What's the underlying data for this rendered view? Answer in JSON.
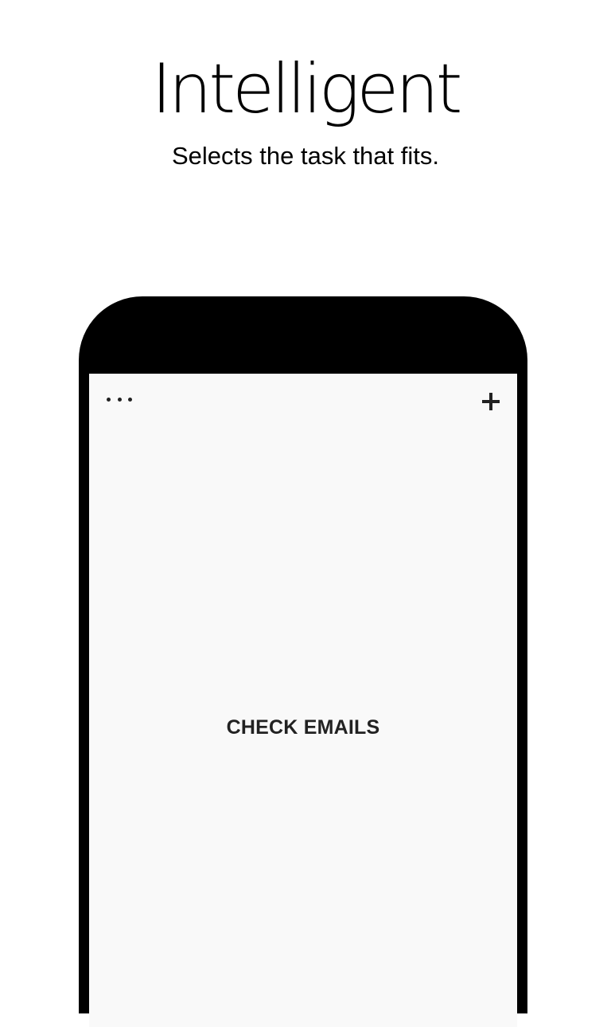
{
  "promo": {
    "headline": "Intelligent",
    "subheadline": "Selects the task that fits."
  },
  "app": {
    "menu_icon": "more-horizontal-icon",
    "add_icon": "plus-icon",
    "current_task": "CHECK EMAILS"
  },
  "colors": {
    "background": "#ffffff",
    "phone_frame": "#000000",
    "screen": "#f9f9f9",
    "text": "#222222"
  }
}
